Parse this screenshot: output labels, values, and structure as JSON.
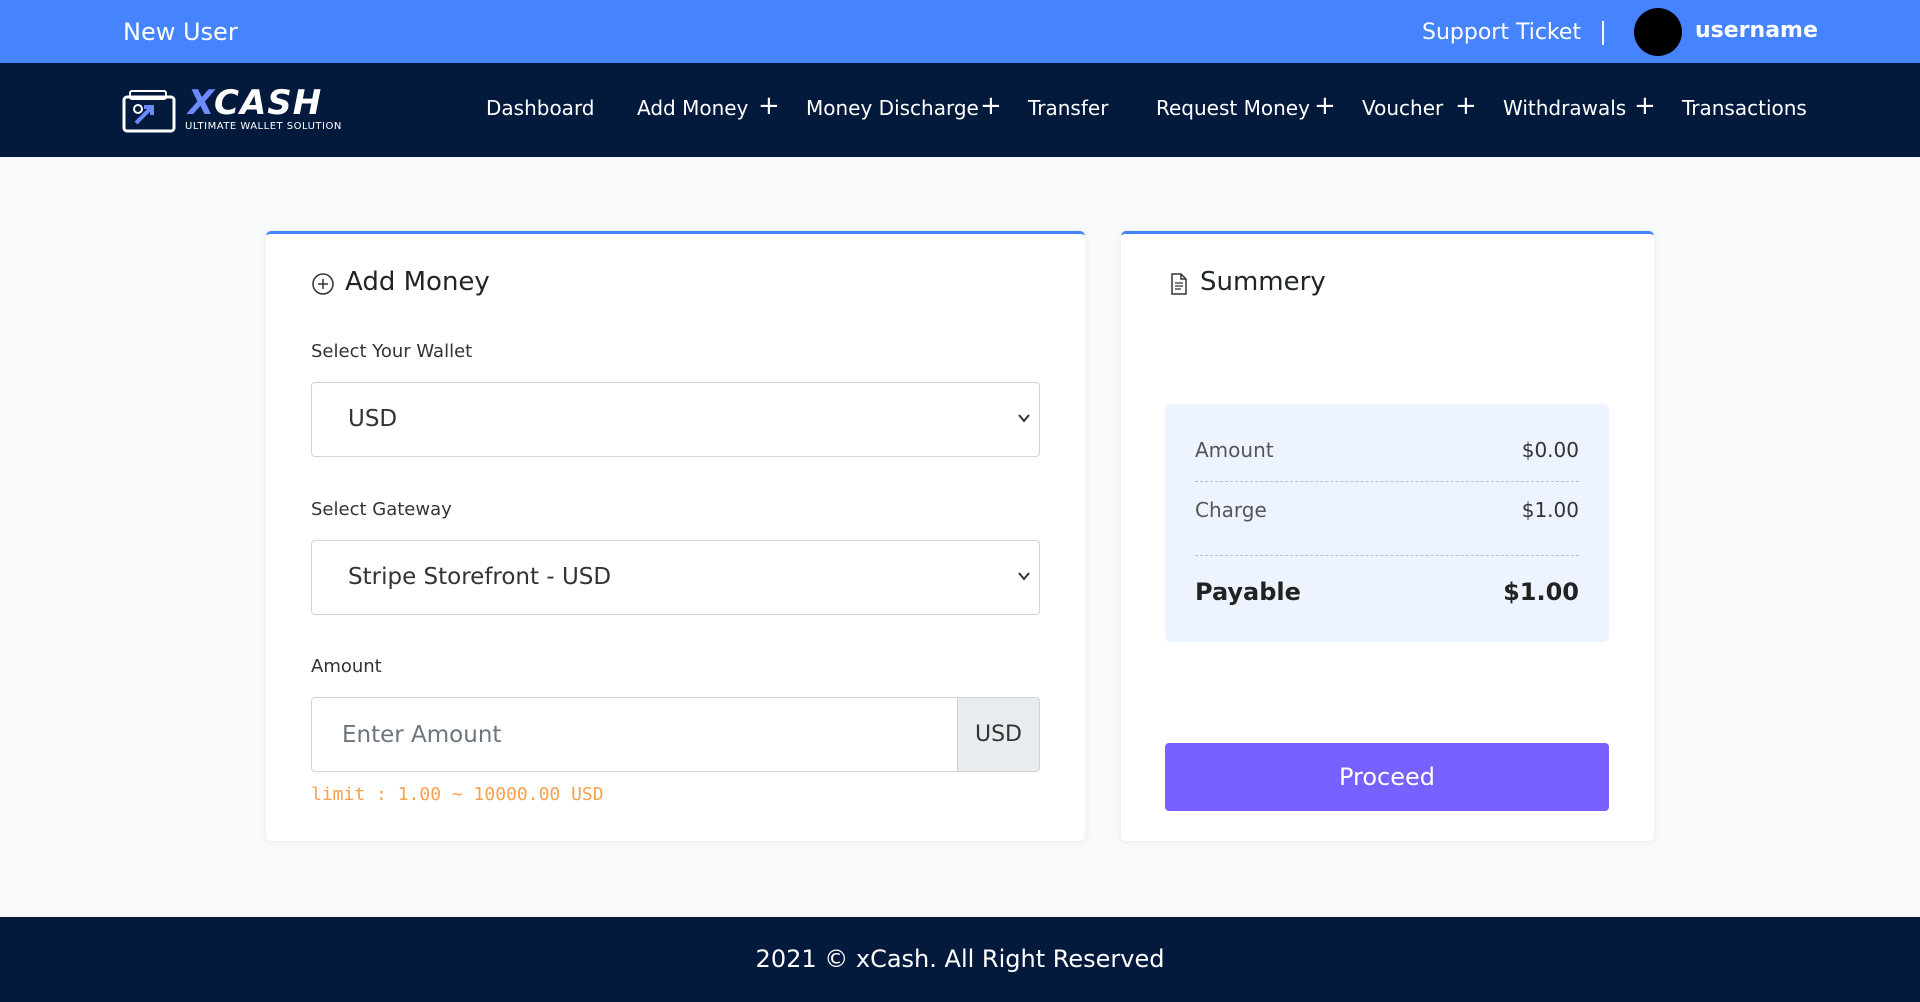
{
  "topbar": {
    "greeting": "New User",
    "support_link": "Support Ticket",
    "username": "username"
  },
  "brand": {
    "name_x": "X",
    "name_rest": "CASH",
    "tagline": "ULTIMATE WALLET SOLUTION"
  },
  "nav": {
    "items": [
      {
        "label": "Dashboard",
        "has_submenu": false
      },
      {
        "label": "Add Money",
        "has_submenu": true
      },
      {
        "label": "Money Discharge",
        "has_submenu": true
      },
      {
        "label": "Transfer",
        "has_submenu": false
      },
      {
        "label": "Request Money",
        "has_submenu": true
      },
      {
        "label": "Voucher",
        "has_submenu": true
      },
      {
        "label": "Withdrawals",
        "has_submenu": true
      },
      {
        "label": "Transactions",
        "has_submenu": false
      }
    ],
    "plus_glyph": "+"
  },
  "add_money": {
    "title": "Add Money",
    "wallet_label": "Select Your Wallet",
    "wallet_value": "USD",
    "gateway_label": "Select Gateway",
    "gateway_value": "Stripe Storefront - USD",
    "amount_label": "Amount",
    "amount_placeholder": "Enter Amount",
    "amount_currency": "USD",
    "limit_text": "limit : 1.00 ~ 10000.00 USD"
  },
  "summary": {
    "title": "Summery",
    "rows": [
      {
        "label": "Amount",
        "value": "$0.00"
      },
      {
        "label": "Charge",
        "value": "$1.00"
      }
    ],
    "total": {
      "label": "Payable",
      "value": "$1.00"
    },
    "proceed_label": "Proceed"
  },
  "footer": {
    "text": "2021 © xCash. All Right Reserved"
  },
  "colors": {
    "topbar": "#4684ff",
    "navbar": "#031a3d",
    "accent_border": "#4684ff",
    "proceed_button": "#7762ff",
    "summary_bg": "#edf3ff",
    "limit_text": "#f5a14e"
  }
}
